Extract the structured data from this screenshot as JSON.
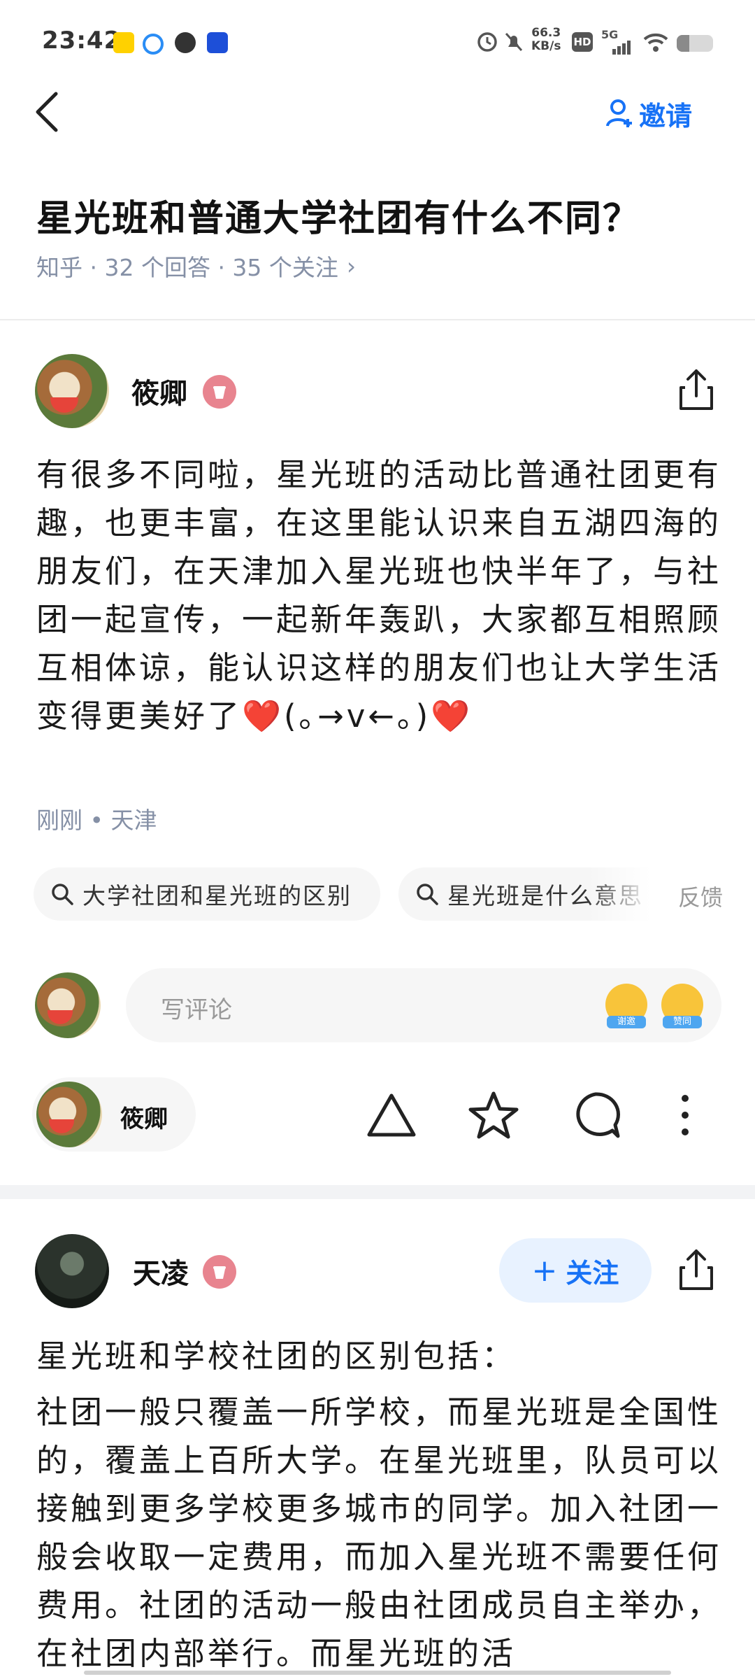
{
  "status_bar": {
    "time": "23:42",
    "net_speed_value": "66.3",
    "net_speed_unit": "KB/s",
    "hd": "HD",
    "network": "5G",
    "battery_level": 0.35,
    "app_icons": [
      "meituan-icon",
      "browser-icon",
      "app-icon",
      "calendar-icon"
    ]
  },
  "nav": {
    "invite_label": "邀请"
  },
  "question": {
    "title": "星光班和普通大学社团有什么不同？",
    "meta": "知乎 · 32 个回答 · 35 个关注",
    "meta_arrow": "›"
  },
  "answers": [
    {
      "author": "筱卿",
      "text": "有很多不同啦，星光班的活动比普通社团更有趣，也更丰富，在这里能认识来自五湖四海的朋友们，在天津加入星光班也快半年了，与社团一起宣传，一起新年轰趴，大家都互相照顾互相体谅，能认识这样的朋友们也让大学生活变得更美好了❤️(｡→v←｡)❤️",
      "time_location": "刚刚 • 天津",
      "related_searches": [
        "大学社团和星光班的区别",
        "星光班是什么意思"
      ],
      "feedback_label": "反馈",
      "comment_placeholder": "写评论",
      "emoji_tags": [
        "谢邀",
        "赞同"
      ],
      "pill_author": "筱卿"
    },
    {
      "author": "天凌",
      "follow_label": "关注",
      "heading": "星光班和学校社团的区别包括：",
      "text": "社团一般只覆盖一所学校，而星光班是全国性的，覆盖上百所大学。在星光班里，队员可以接触到更多学校更多城市的同学。加入社团一般会收取一定费用，而加入星光班不需要任何费用。社团的活动一般由社团成员自主举办，在社团内部举行。而星光班的活"
    }
  ]
}
